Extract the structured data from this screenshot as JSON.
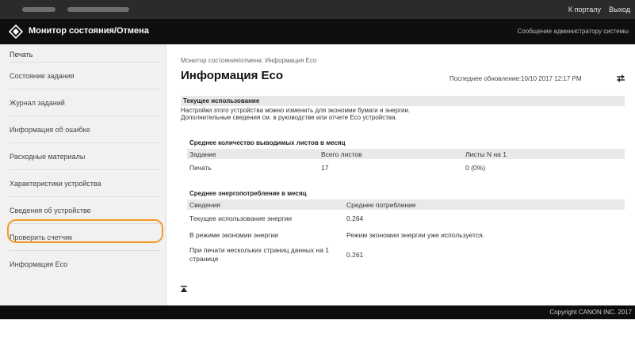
{
  "topbar": {
    "portal_link": "К порталу",
    "logout_link": "Выход"
  },
  "header": {
    "title": "Монитор состояния/Отмена",
    "admin_message": "Сообщение администратору системы"
  },
  "sidebar": {
    "section_label": "Печать",
    "items": [
      {
        "label": "Состояние задания"
      },
      {
        "label": "Журнал заданий"
      },
      {
        "label": "Информация об ошибке"
      },
      {
        "label": "Расходные материалы"
      },
      {
        "label": "Характеристики устройства"
      },
      {
        "label": "Сведения об устройстве"
      },
      {
        "label": "Проверить счетчик"
      },
      {
        "label": "Информация Eco"
      }
    ],
    "selected_item": "Информация Eco"
  },
  "main": {
    "breadcrumb": "Монитор состояния/отмена: Информация Eco",
    "page_title": "Информация Eco",
    "last_update_label": "Последнее обновление:",
    "last_update_value": "10/10 2017 12:17 PM",
    "current_usage": {
      "heading": "Текущее использование",
      "line1": "Настройки этого устройства можно изменить для экономии бумаги и энергии.",
      "line2": "Дополнительные сведения см. в руководстве или отчете Eco устройства."
    },
    "sheets_section": {
      "title": "Среднее количество выводимых листов в месяц",
      "headers": [
        "Задание",
        "Всего листов",
        "Листы N на 1"
      ],
      "rows": [
        [
          "Печать",
          "17",
          "0 (0%)"
        ]
      ]
    },
    "energy_section": {
      "title": "Среднее энергопотребление в месяц",
      "headers": [
        "Сведения",
        "Среднее потребление"
      ],
      "rows": [
        [
          "Текущее использование энергии",
          "0.264"
        ],
        [
          "В режиме экономии энергии",
          "Режим экономии энергии уже используется."
        ],
        [
          "При печати нескольких страниц данных на 1 странице",
          "0.261"
        ]
      ]
    }
  },
  "footer": {
    "copyright": "Copyright CANON INC. 2017"
  },
  "colors": {
    "highlight": "#f29b25",
    "titlebar_bg": "#0f0f0f",
    "topbar_bg": "#2b2b2b",
    "sidebar_bg": "#f1f1f1"
  },
  "icons": {
    "logo": "canon-logo-icon",
    "refresh": "refresh-icon",
    "scroll_top": "scroll-to-top-icon"
  }
}
